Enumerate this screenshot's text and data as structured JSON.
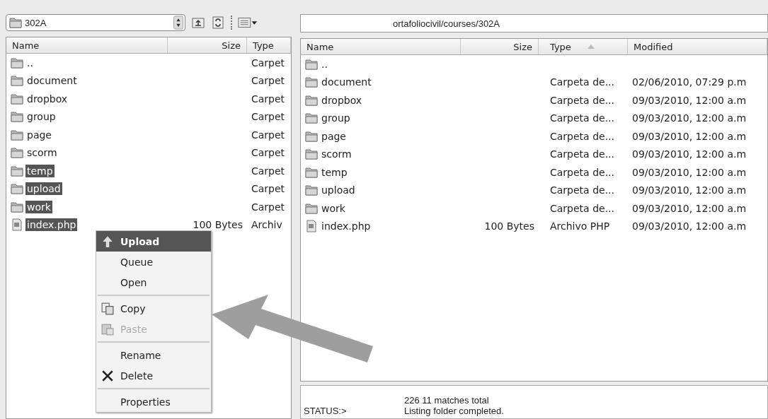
{
  "local": {
    "path_combo": "302A",
    "columns": [
      {
        "label": "Name"
      },
      {
        "label": "Size"
      },
      {
        "label": "Type"
      }
    ],
    "rows": [
      {
        "kind": "folder",
        "name": "..",
        "size": "",
        "type": "Carpet",
        "selected": false
      },
      {
        "kind": "folder",
        "name": "document",
        "size": "",
        "type": "Carpet",
        "selected": false
      },
      {
        "kind": "folder",
        "name": "dropbox",
        "size": "",
        "type": "Carpet",
        "selected": false
      },
      {
        "kind": "folder",
        "name": "group",
        "size": "",
        "type": "Carpet",
        "selected": false
      },
      {
        "kind": "folder",
        "name": "page",
        "size": "",
        "type": "Carpet",
        "selected": false
      },
      {
        "kind": "folder",
        "name": "scorm",
        "size": "",
        "type": "Carpet",
        "selected": false
      },
      {
        "kind": "folder",
        "name": "temp",
        "size": "",
        "type": "Carpet",
        "selected": true
      },
      {
        "kind": "folder",
        "name": "upload",
        "size": "",
        "type": "Carpet",
        "selected": true
      },
      {
        "kind": "folder",
        "name": "work",
        "size": "",
        "type": "Carpet",
        "selected": true
      },
      {
        "kind": "file",
        "name": "index.php",
        "size": "100 Bytes",
        "type": "Archiv",
        "selected": true
      }
    ]
  },
  "context_menu": {
    "items": [
      {
        "label": "Upload",
        "selected": true,
        "disabled": false,
        "separator_before": false
      },
      {
        "label": "Queue",
        "selected": false,
        "disabled": false,
        "separator_before": false
      },
      {
        "label": "Open",
        "selected": false,
        "disabled": false,
        "separator_before": false
      },
      {
        "label": "Copy",
        "selected": false,
        "disabled": false,
        "separator_before": true
      },
      {
        "label": "Paste",
        "selected": false,
        "disabled": true,
        "separator_before": false
      },
      {
        "label": "Rename",
        "selected": false,
        "disabled": false,
        "separator_before": true
      },
      {
        "label": "Delete",
        "selected": false,
        "disabled": false,
        "separator_before": false
      },
      {
        "label": "Properties",
        "selected": false,
        "disabled": false,
        "separator_before": true
      }
    ]
  },
  "remote": {
    "path": "ortafoliocivil/courses/302A",
    "columns": [
      {
        "label": "Name",
        "sorted": false
      },
      {
        "label": "Size",
        "sorted": false
      },
      {
        "label": "Type",
        "sorted": true
      },
      {
        "label": "Modified",
        "sorted": false
      }
    ],
    "rows": [
      {
        "kind": "folder",
        "name": "..",
        "size": "",
        "type": "",
        "modified": ""
      },
      {
        "kind": "folder",
        "name": "document",
        "size": "",
        "type": "Carpeta de...",
        "modified": "02/06/2010, 07:29 p.m"
      },
      {
        "kind": "folder",
        "name": "dropbox",
        "size": "",
        "type": "Carpeta de...",
        "modified": "09/03/2010, 12:00 a.m"
      },
      {
        "kind": "folder",
        "name": "group",
        "size": "",
        "type": "Carpeta de...",
        "modified": "09/03/2010, 12:00 a.m"
      },
      {
        "kind": "folder",
        "name": "page",
        "size": "",
        "type": "Carpeta de...",
        "modified": "09/03/2010, 12:00 a.m"
      },
      {
        "kind": "folder",
        "name": "scorm",
        "size": "",
        "type": "Carpeta de...",
        "modified": "09/03/2010, 12:00 a.m"
      },
      {
        "kind": "folder",
        "name": "temp",
        "size": "",
        "type": "Carpeta de...",
        "modified": "09/03/2010, 12:00 a.m"
      },
      {
        "kind": "folder",
        "name": "upload",
        "size": "",
        "type": "Carpeta de...",
        "modified": "09/03/2010, 12:00 a.m"
      },
      {
        "kind": "folder",
        "name": "work",
        "size": "",
        "type": "Carpeta de...",
        "modified": "09/03/2010, 12:00 a.m"
      },
      {
        "kind": "file",
        "name": "index.php",
        "size": "100 Bytes",
        "type": "Archivo PHP",
        "modified": "09/03/2010, 12:00 a.m"
      }
    ]
  },
  "status": {
    "label": "STATUS:>",
    "lines": [
      "226 11 matches total",
      "Listing folder completed."
    ]
  }
}
